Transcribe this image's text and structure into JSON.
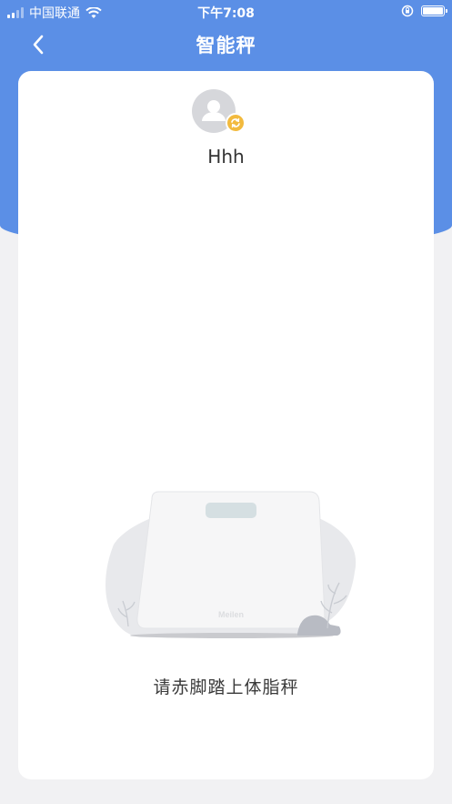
{
  "status_bar": {
    "carrier": "中国联通",
    "time": "下午7:08"
  },
  "nav": {
    "title": "智能秤",
    "back_icon": "chevron-left-icon"
  },
  "profile": {
    "user_name": "Hhh",
    "avatar_icon": "user-avatar-icon",
    "switch_icon": "switch-user-icon"
  },
  "illustration": {
    "brand_text": "Meilen"
  },
  "prompt_text": "请赤脚踏上体脂秤",
  "colors": {
    "accent": "#5b8fe6",
    "background": "#f1f1f3",
    "badge": "#f2ba3e"
  }
}
